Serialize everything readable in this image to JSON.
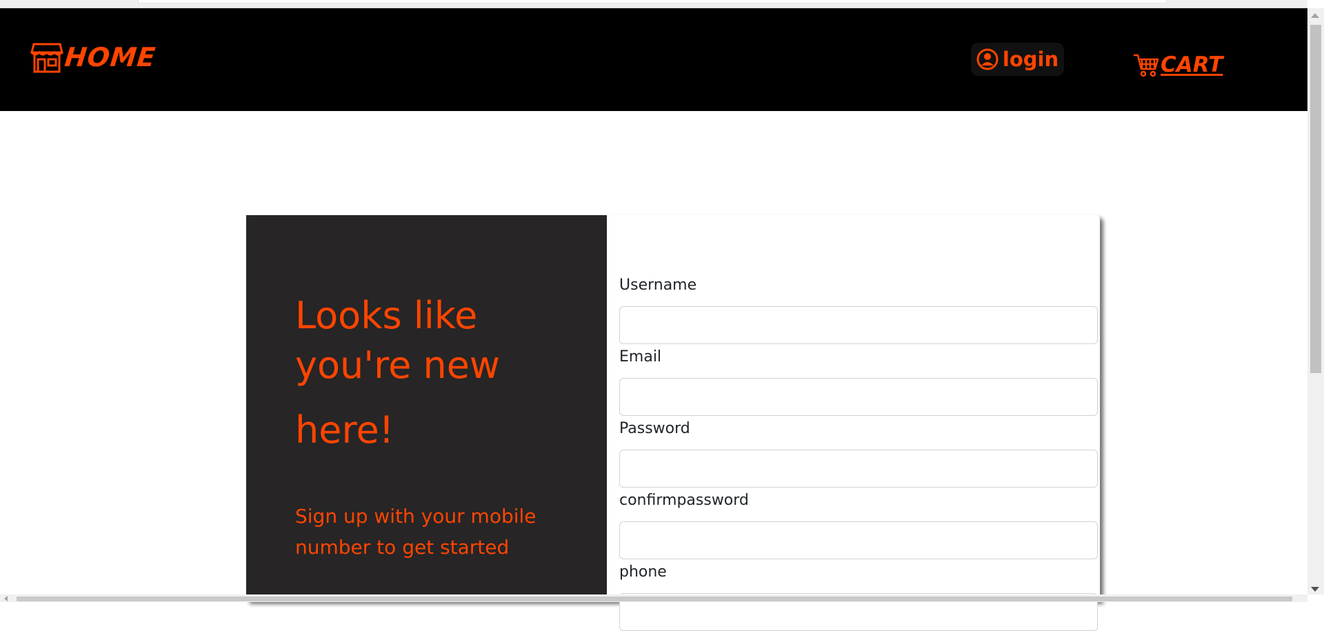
{
  "header": {
    "brand_label": "HOME",
    "brand_icon": "store-icon",
    "login_label": "login",
    "login_icon": "user-circle-icon",
    "cart_label": "CART",
    "cart_icon": "cart-icon"
  },
  "colors": {
    "accent": "#ff4500",
    "navbar": "#000000",
    "panel": "#272526",
    "text": "#212529"
  },
  "promo": {
    "headline_line1": "Looks like",
    "headline_line2": "you're new",
    "headline_line3": "here!",
    "subtext": "Sign up with your mobile number to get started"
  },
  "form": {
    "fields": [
      {
        "label": "Username",
        "value": ""
      },
      {
        "label": "Email",
        "value": ""
      },
      {
        "label": "Password",
        "value": ""
      },
      {
        "label": "confirmpassword",
        "value": ""
      },
      {
        "label": "phone",
        "value": ""
      }
    ]
  }
}
